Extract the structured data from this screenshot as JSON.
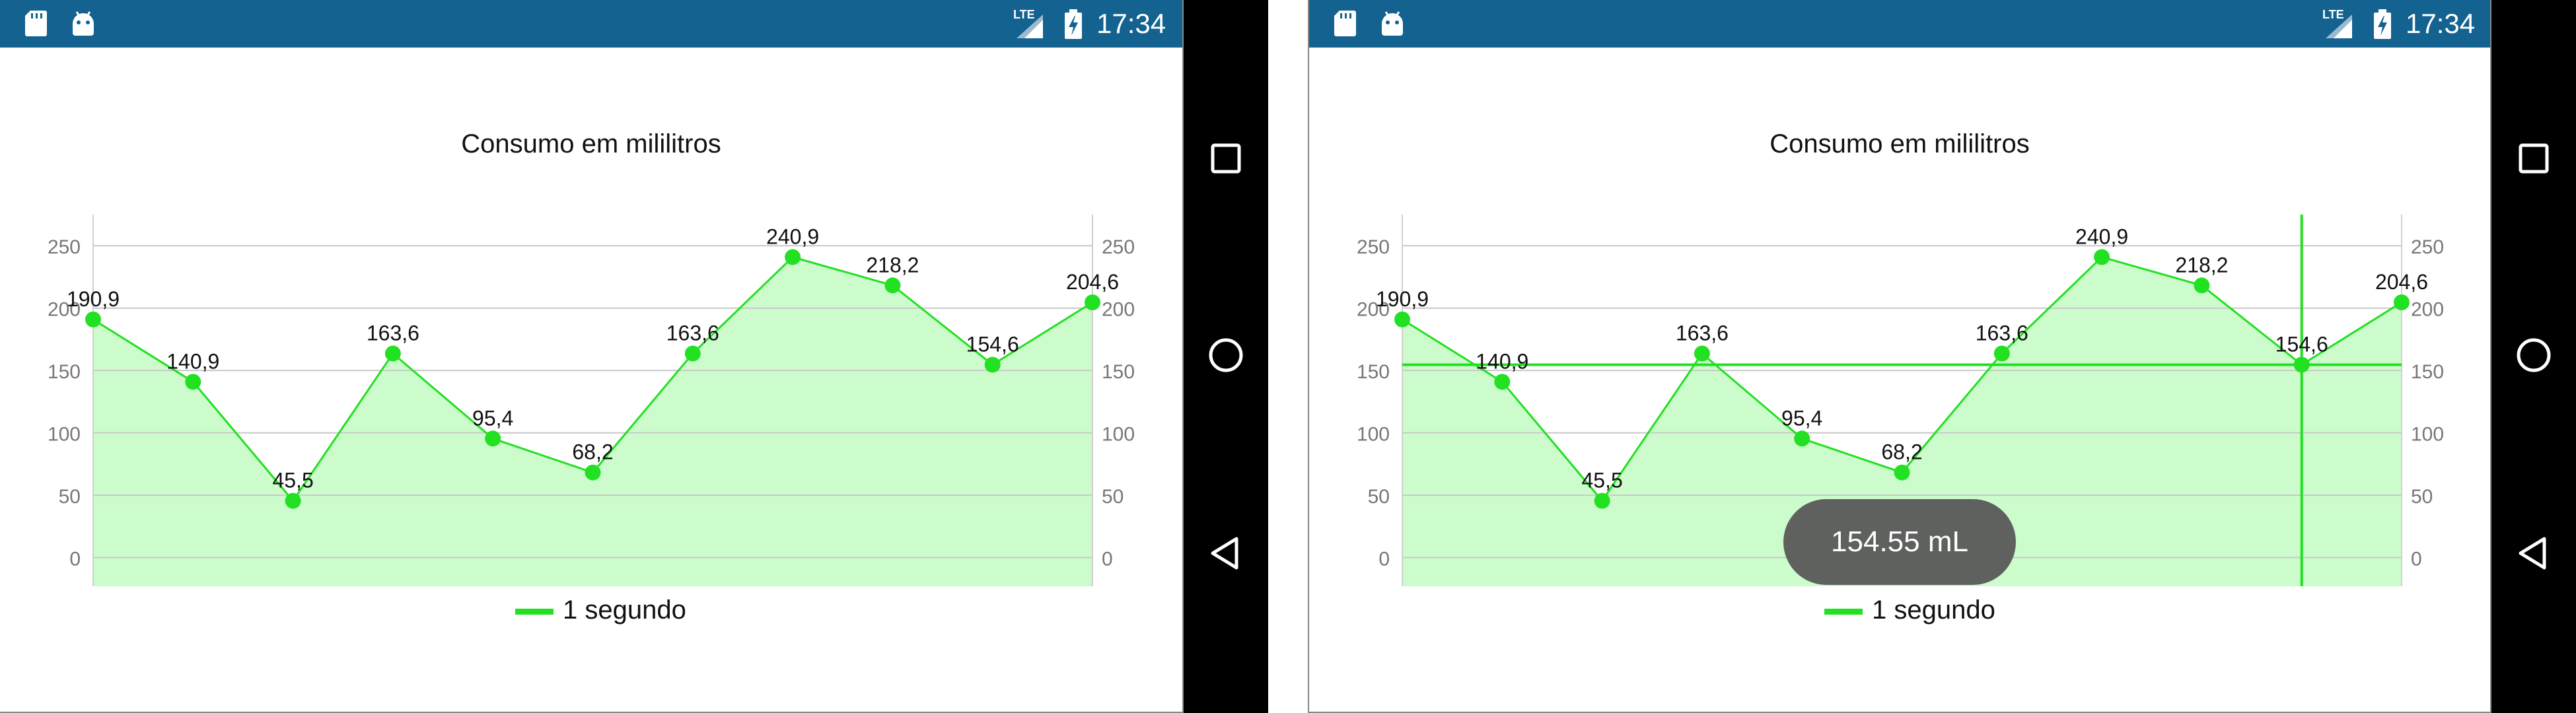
{
  "status_bar": {
    "time": "17:34",
    "network": "LTE"
  },
  "chart": {
    "title": "Consumo em mililitros",
    "legend_label": "1 segundo",
    "y_ticks": [
      "0",
      "50",
      "100",
      "150",
      "200",
      "250"
    ]
  },
  "chart_data": {
    "type": "area",
    "title": "Consumo em mililitros",
    "x": [
      1,
      2,
      3,
      4,
      5,
      6,
      7,
      8,
      9,
      10,
      11
    ],
    "series": [
      {
        "name": "1 segundo",
        "values": [
          190.9,
          140.9,
          45.5,
          163.6,
          95.4,
          68.2,
          163.6,
          240.9,
          218.2,
          154.6,
          204.6
        ],
        "labels": [
          "190,9",
          "140,9",
          "45,5",
          "163,6",
          "95,4",
          "68,2",
          "163,6",
          "240,9",
          "218,2",
          "154,6",
          "204,6"
        ]
      }
    ],
    "ylim": [
      -23,
      275
    ],
    "y_ticks": [
      0,
      50,
      100,
      150,
      200,
      250
    ],
    "grid": true,
    "legend": "bottom-center",
    "colors": {
      "line": "#22e022",
      "fill": "#ccfccc",
      "marker": "#22e022"
    }
  },
  "highlight": {
    "point_index": 9,
    "value_text": "154.55 mL"
  },
  "colors": {
    "status_bar": "#136290",
    "nav_bar": "#000000",
    "toast": "#5f615f"
  },
  "nav": {
    "recents_icon": "square-icon",
    "home_icon": "circle-icon",
    "back_icon": "triangle-back-icon"
  }
}
